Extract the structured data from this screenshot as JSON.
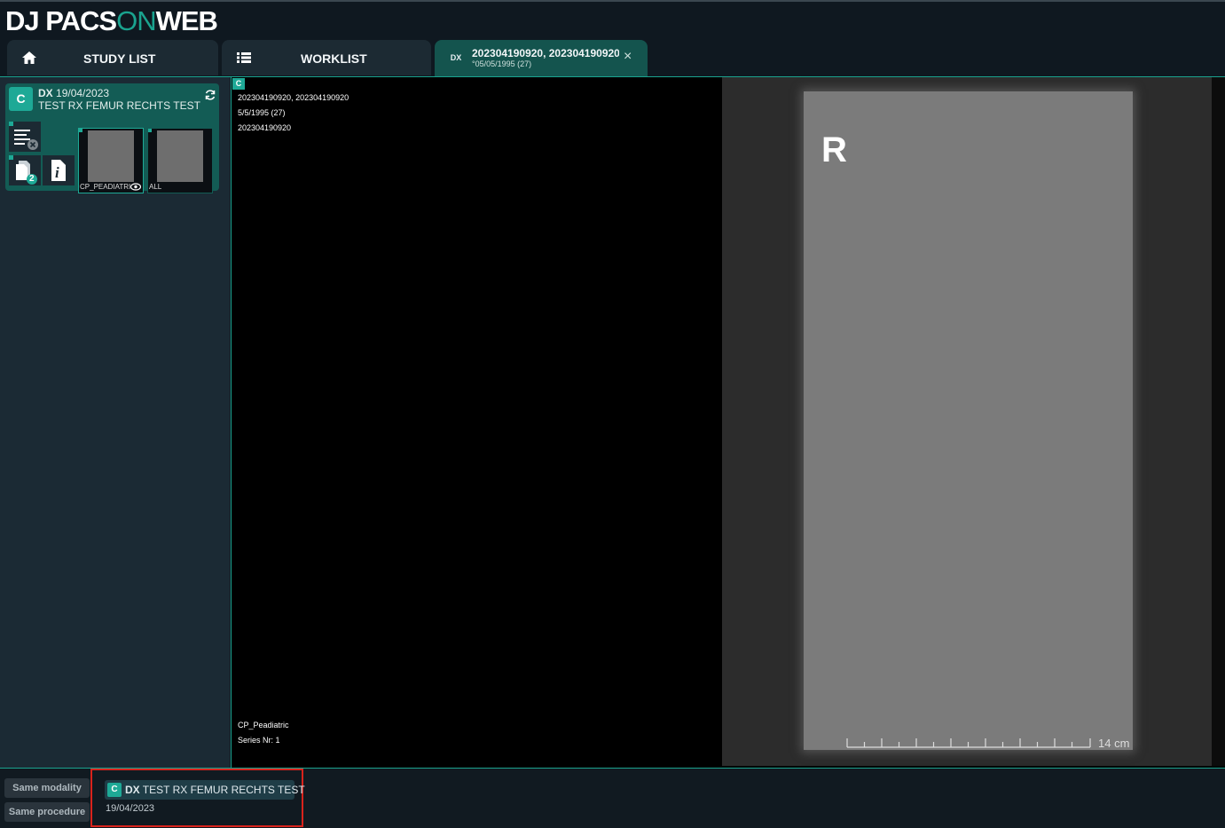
{
  "app": {
    "logo_left": "DJ PACS",
    "logo_on": "ON",
    "logo_right": "WEB"
  },
  "tabs": {
    "study_list": "STUDY LIST",
    "worklist": "WORKLIST",
    "active": {
      "modality": "DX",
      "title": "202304190920, 202304190920",
      "subtitle": "°05/05/1995 (27)",
      "close": "×"
    }
  },
  "study": {
    "badge": "C",
    "modality": "DX",
    "date": "19/04/2023",
    "description": "TEST RX FEMUR RECHTS TEST",
    "docs_count": "2",
    "info_glyph": "i",
    "thumbnails": [
      {
        "label": "CP_PEADIATRIC"
      },
      {
        "label": "ALL"
      }
    ]
  },
  "viewer": {
    "badge": "C",
    "overlay_top": [
      "202304190920, 202304190920",
      "5/5/1995 (27)",
      "202304190920"
    ],
    "overlay_bottom": [
      "CP_Peadiatric",
      "Series Nr: 1"
    ],
    "marker": "R",
    "scale_label": "14 cm"
  },
  "bottom": {
    "filter_same_modality": "Same modality",
    "filter_same_procedure": "Same procedure",
    "related": {
      "badge": "C",
      "modality": "DX",
      "description": "TEST RX FEMUR RECHTS TEST",
      "date": "19/04/2023"
    }
  },
  "colors": {
    "accent": "#1aa38f",
    "active_tab": "#14544e",
    "highlight_border": "#d9231c"
  }
}
